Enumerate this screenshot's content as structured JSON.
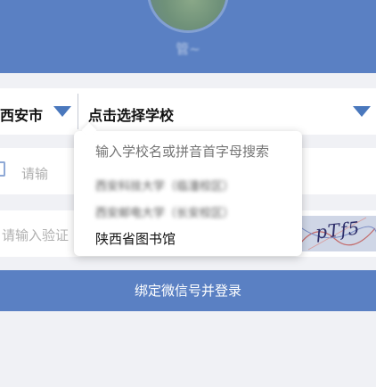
{
  "header": {
    "username": "管~"
  },
  "selectors": {
    "city": "西安市",
    "school": "点击选择学校"
  },
  "inputs": {
    "phone_placeholder": "请输",
    "code_placeholder": "请输入验证"
  },
  "captcha": {
    "text": "pTf5"
  },
  "button": {
    "label": "绑定微信号并登录"
  },
  "dropdown": {
    "search_placeholder": "输入学校名或拼音首字母搜索",
    "items": [
      {
        "label": "西安科技大学（临潼校区）"
      },
      {
        "label": "西安邮电大学（长安校区）"
      },
      {
        "label": "陕西省图书馆"
      }
    ]
  },
  "colors": {
    "brand": "#5a80c3",
    "arrow": "#4a78bd",
    "background": "#f0f1f5"
  }
}
